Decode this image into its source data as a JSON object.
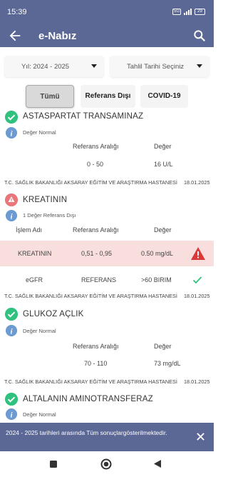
{
  "status_bar": {
    "time": "15:39",
    "sim_label": "5G",
    "battery": "29"
  },
  "app_bar": {
    "title": "e-Nabız"
  },
  "filters": {
    "year": "Yıl: 2024 - 2025",
    "date": "Tahlil Tarihi Seçiniz"
  },
  "tabs": [
    {
      "label": "Tümü"
    },
    {
      "label": "Referans Dışı"
    },
    {
      "label": "COVID-19"
    }
  ],
  "tests": [
    {
      "name": "ASTASPARTAT TRANSAMINAZ",
      "status": "Değer Normal",
      "col_ref": "Referans Aralığı",
      "col_val": "Değer",
      "ref": "0 - 50",
      "value": "16 U/L",
      "hospital": "T.C. SAĞLIK BAKANLIĞI AKSARAY EĞİTİM VE ARAŞTIRMA HASTANESİ",
      "date": "18.01.2025"
    },
    {
      "name": "KREATININ",
      "status": "1 Değer Referans Dışı",
      "col_name": "İşlem Adı",
      "col_ref": "Referans Aralığı",
      "col_val": "Değer",
      "rows": [
        {
          "name": "KREATININ",
          "ref": "0,51 - 0,95",
          "value": "0.50 mg/dL"
        },
        {
          "name": "eGFR",
          "ref": "REFERANS",
          "value": ">60 BIRIM"
        }
      ],
      "hospital": "T.C. SAĞLIK BAKANLIĞI AKSARAY EĞİTİM VE ARAŞTIRMA HASTANESİ",
      "date": "18.01.2025"
    },
    {
      "name": "GLUKOZ AÇLIK",
      "status": "Değer Normal",
      "col_ref": "Referans Aralığı",
      "col_val": "Değer",
      "ref": "70 - 110",
      "value": "73 mg/dL",
      "hospital": "T.C. SAĞLIK BAKANLIĞI AKSARAY EĞİTİM VE ARAŞTIRMA HASTANESİ",
      "date": "18.01.2025"
    },
    {
      "name": "ALTALANIN AMINOTRANSFERAZ",
      "status": "Değer Normal"
    }
  ],
  "snackbar": {
    "message": "2024 - 2025 tarihleri arasında Tüm sonuçlargösterilmektedir."
  },
  "colors": {
    "primary": "#5b6794",
    "ok": "#2ec27e",
    "info": "#6b9bd2",
    "warn": "#e8767a",
    "alert_row": "#f8dedd",
    "alert_icon": "#d83a3a"
  }
}
